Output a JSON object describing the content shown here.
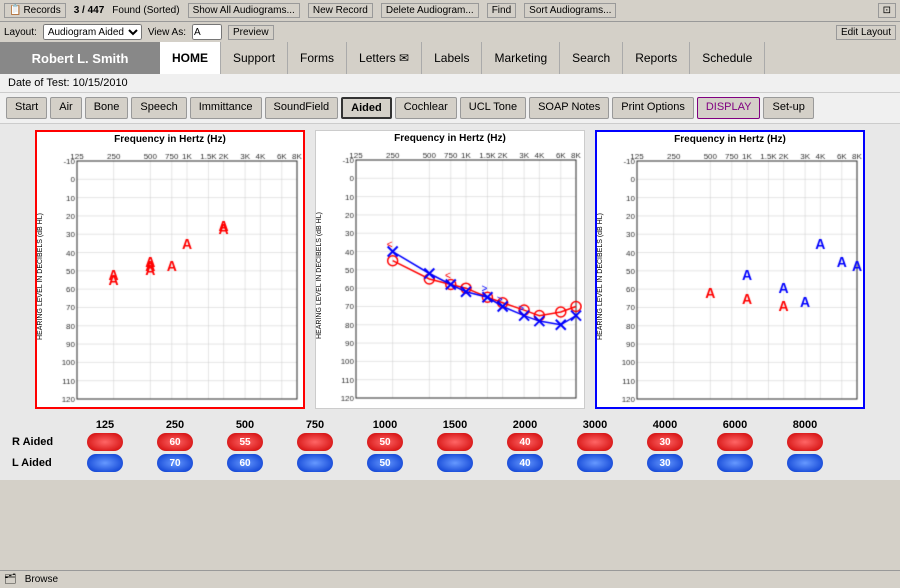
{
  "toolbar": {
    "records_label": "Records",
    "record_count": "3 / 447",
    "found_sorted": "Found (Sorted)",
    "show_all": "Show All Audiograms...",
    "new_record": "New Record",
    "delete_audiogram": "Delete Audiogram...",
    "find": "Find",
    "sort_audiograms": "Sort Audiograms..."
  },
  "layout_bar": {
    "layout_label": "Layout:",
    "audiogram_aided": "Audiogram Aided",
    "view_as": "View As:",
    "preview": "Preview",
    "edit_layout": "Edit Layout"
  },
  "patient": {
    "name": "Robert L. Smith",
    "date_label": "Date of Test:",
    "date_value": "10/15/2010"
  },
  "nav": {
    "home": "HOME",
    "support": "Support",
    "forms": "Forms",
    "letters": "Letters ✉",
    "labels": "Labels",
    "marketing": "Marketing",
    "search": "Search",
    "reports": "Reports",
    "schedule": "Schedule"
  },
  "sub_tabs": {
    "start": "Start",
    "air": "Air",
    "bone": "Bone",
    "speech": "Speech",
    "immittance": "Immittance",
    "soundfield": "SoundField",
    "aided": "Aided",
    "cochlear": "Cochlear",
    "ucl_tone": "UCL Tone",
    "soap_notes": "SOAP Notes",
    "print_options": "Print Options",
    "display": "DISPLAY",
    "set_up": "Set-up"
  },
  "charts": {
    "left": {
      "title": "Frequency in Hertz (Hz)",
      "freqs": [
        "125",
        "250",
        "500",
        "750",
        "1000",
        "2000",
        "3000",
        "4000",
        "6000",
        "8000"
      ],
      "y_label": "HEARING LEVEL IN DECIBELS (dB HL)"
    },
    "middle": {
      "title": "Frequency in Hertz (Hz)",
      "freqs": [
        "125",
        "250",
        "500",
        "750",
        "1000",
        "2000",
        "3000",
        "4000",
        "6000",
        "8000"
      ],
      "y_label": "HEARING LEVEL IN DECIBELS (dB HL)"
    },
    "right": {
      "title": "Frequency in Hertz (Hz)",
      "freqs": [
        "125",
        "250",
        "500",
        "750",
        "1000",
        "2000",
        "3000",
        "4000",
        "6000",
        "8000"
      ],
      "y_label": "HEARING LEVEL IN DECIBELS (dB HL)"
    }
  },
  "data_section": {
    "freq_headers": [
      "125",
      "250",
      "500",
      "750",
      "1000",
      "1500",
      "2000",
      "3000",
      "4000",
      "6000",
      "8000"
    ],
    "r_aided_label": "R Aided",
    "l_aided_label": "L Aided",
    "r_values": {
      "250": "60",
      "500": "55",
      "1000": "50",
      "2000": "40",
      "4000": "30"
    },
    "l_values": {
      "250": "70",
      "500": "60",
      "1000": "50",
      "2000": "40",
      "4000": "30"
    }
  },
  "status": {
    "browse": "Browse"
  }
}
